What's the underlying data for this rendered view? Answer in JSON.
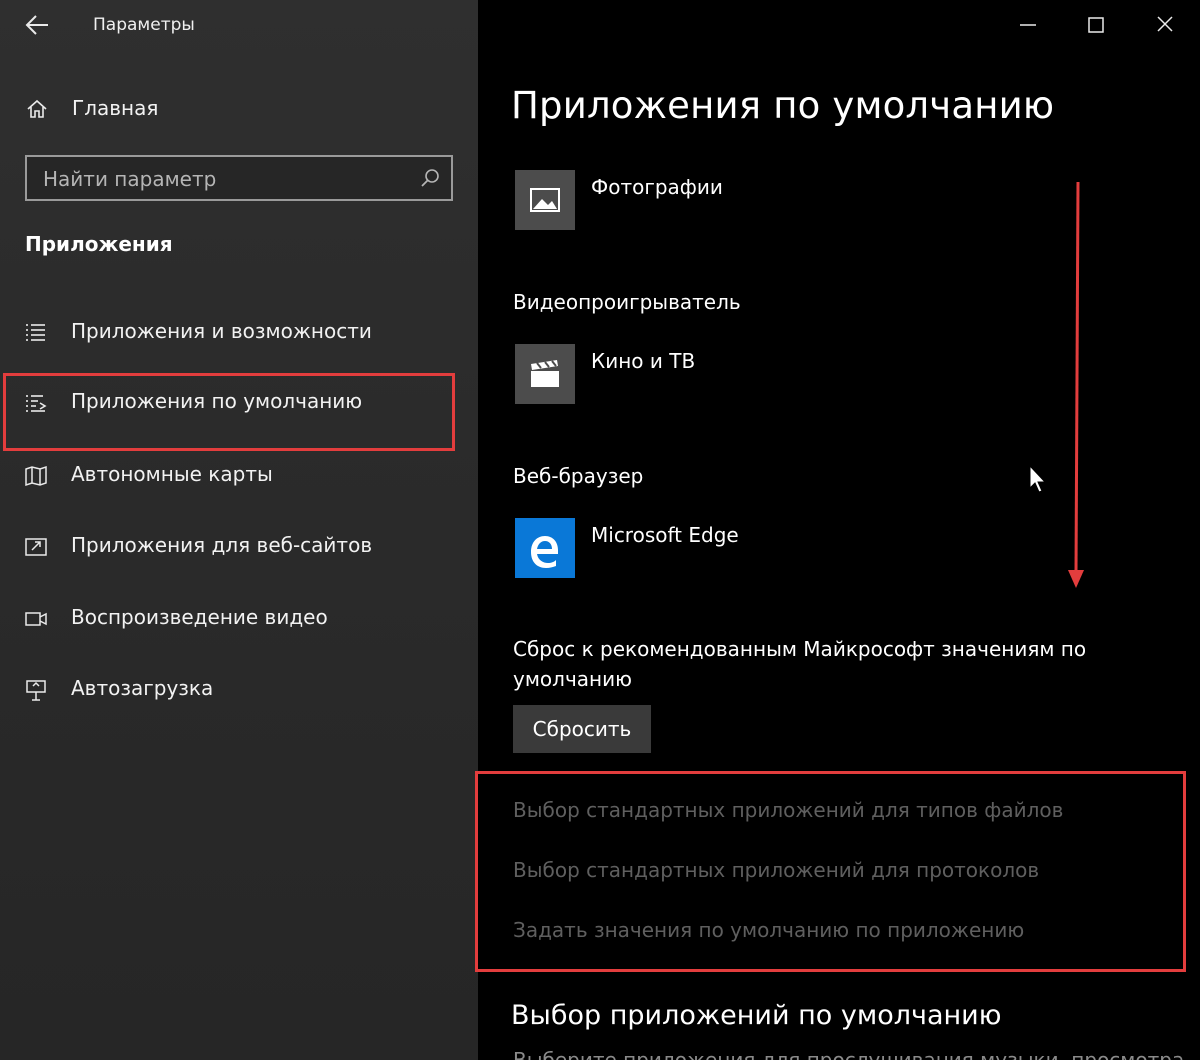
{
  "window": {
    "title": "Параметры",
    "back_icon": "arrow-left-icon",
    "controls": [
      "minimize-icon",
      "maximize-icon",
      "close-icon"
    ]
  },
  "sidebar": {
    "home_label": "Главная",
    "search_placeholder": "Найти параметр",
    "section_title": "Приложения",
    "items": [
      {
        "label": "Приложения и возможности",
        "icon": "list-icon",
        "selected": false
      },
      {
        "label": "Приложения по умолчанию",
        "icon": "default-apps-icon",
        "selected": true
      },
      {
        "label": "Автономные карты",
        "icon": "map-icon",
        "selected": false
      },
      {
        "label": "Приложения для веб-сайтов",
        "icon": "web-app-icon",
        "selected": false
      },
      {
        "label": "Воспроизведение видео",
        "icon": "video-camera-icon",
        "selected": false
      },
      {
        "label": "Автозагрузка",
        "icon": "startup-icon",
        "selected": false
      }
    ]
  },
  "main": {
    "title": "Приложения по умолчанию",
    "photo_viewer": {
      "app": "Фотографии",
      "icon": "photo-icon"
    },
    "video_player": {
      "category": "Видеопроигрыватель",
      "app": "Кино и ТВ",
      "icon": "clapperboard-icon"
    },
    "web_browser": {
      "category": "Веб-браузер",
      "app": "Microsoft Edge",
      "icon": "edge-icon"
    },
    "reset": {
      "text": "Сброс к рекомендованным Майкрософт значениям по умолчанию",
      "button_label": "Сбросить"
    },
    "links": [
      "Выбор стандартных приложений для типов файлов",
      "Выбор стандартных приложений для протоколов",
      "Задать значения по умолчанию по приложению"
    ],
    "section_heading": "Выбор приложений по умолчанию",
    "section_desc": "Выберите приложения для прослушивания музыки, просмотра"
  },
  "colors": {
    "highlight": "#e33d3d",
    "sidebar_bg": "#2b2b2b",
    "content_bg": "#000000",
    "tile_gray": "#4c4c4c",
    "edge_blue": "#0a78d7",
    "disabled_link": "#5f5f5f"
  }
}
